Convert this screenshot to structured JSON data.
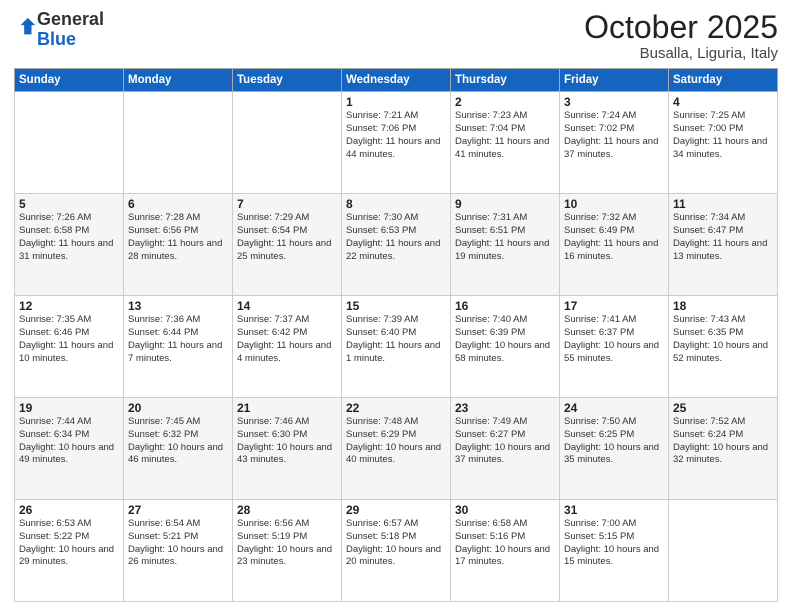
{
  "header": {
    "logo_general": "General",
    "logo_blue": "Blue",
    "month": "October 2025",
    "location": "Busalla, Liguria, Italy"
  },
  "weekdays": [
    "Sunday",
    "Monday",
    "Tuesday",
    "Wednesday",
    "Thursday",
    "Friday",
    "Saturday"
  ],
  "weeks": [
    [
      {
        "day": "",
        "info": ""
      },
      {
        "day": "",
        "info": ""
      },
      {
        "day": "",
        "info": ""
      },
      {
        "day": "1",
        "info": "Sunrise: 7:21 AM\nSunset: 7:06 PM\nDaylight: 11 hours and 44 minutes."
      },
      {
        "day": "2",
        "info": "Sunrise: 7:23 AM\nSunset: 7:04 PM\nDaylight: 11 hours and 41 minutes."
      },
      {
        "day": "3",
        "info": "Sunrise: 7:24 AM\nSunset: 7:02 PM\nDaylight: 11 hours and 37 minutes."
      },
      {
        "day": "4",
        "info": "Sunrise: 7:25 AM\nSunset: 7:00 PM\nDaylight: 11 hours and 34 minutes."
      }
    ],
    [
      {
        "day": "5",
        "info": "Sunrise: 7:26 AM\nSunset: 6:58 PM\nDaylight: 11 hours and 31 minutes."
      },
      {
        "day": "6",
        "info": "Sunrise: 7:28 AM\nSunset: 6:56 PM\nDaylight: 11 hours and 28 minutes."
      },
      {
        "day": "7",
        "info": "Sunrise: 7:29 AM\nSunset: 6:54 PM\nDaylight: 11 hours and 25 minutes."
      },
      {
        "day": "8",
        "info": "Sunrise: 7:30 AM\nSunset: 6:53 PM\nDaylight: 11 hours and 22 minutes."
      },
      {
        "day": "9",
        "info": "Sunrise: 7:31 AM\nSunset: 6:51 PM\nDaylight: 11 hours and 19 minutes."
      },
      {
        "day": "10",
        "info": "Sunrise: 7:32 AM\nSunset: 6:49 PM\nDaylight: 11 hours and 16 minutes."
      },
      {
        "day": "11",
        "info": "Sunrise: 7:34 AM\nSunset: 6:47 PM\nDaylight: 11 hours and 13 minutes."
      }
    ],
    [
      {
        "day": "12",
        "info": "Sunrise: 7:35 AM\nSunset: 6:46 PM\nDaylight: 11 hours and 10 minutes."
      },
      {
        "day": "13",
        "info": "Sunrise: 7:36 AM\nSunset: 6:44 PM\nDaylight: 11 hours and 7 minutes."
      },
      {
        "day": "14",
        "info": "Sunrise: 7:37 AM\nSunset: 6:42 PM\nDaylight: 11 hours and 4 minutes."
      },
      {
        "day": "15",
        "info": "Sunrise: 7:39 AM\nSunset: 6:40 PM\nDaylight: 11 hours and 1 minute."
      },
      {
        "day": "16",
        "info": "Sunrise: 7:40 AM\nSunset: 6:39 PM\nDaylight: 10 hours and 58 minutes."
      },
      {
        "day": "17",
        "info": "Sunrise: 7:41 AM\nSunset: 6:37 PM\nDaylight: 10 hours and 55 minutes."
      },
      {
        "day": "18",
        "info": "Sunrise: 7:43 AM\nSunset: 6:35 PM\nDaylight: 10 hours and 52 minutes."
      }
    ],
    [
      {
        "day": "19",
        "info": "Sunrise: 7:44 AM\nSunset: 6:34 PM\nDaylight: 10 hours and 49 minutes."
      },
      {
        "day": "20",
        "info": "Sunrise: 7:45 AM\nSunset: 6:32 PM\nDaylight: 10 hours and 46 minutes."
      },
      {
        "day": "21",
        "info": "Sunrise: 7:46 AM\nSunset: 6:30 PM\nDaylight: 10 hours and 43 minutes."
      },
      {
        "day": "22",
        "info": "Sunrise: 7:48 AM\nSunset: 6:29 PM\nDaylight: 10 hours and 40 minutes."
      },
      {
        "day": "23",
        "info": "Sunrise: 7:49 AM\nSunset: 6:27 PM\nDaylight: 10 hours and 37 minutes."
      },
      {
        "day": "24",
        "info": "Sunrise: 7:50 AM\nSunset: 6:25 PM\nDaylight: 10 hours and 35 minutes."
      },
      {
        "day": "25",
        "info": "Sunrise: 7:52 AM\nSunset: 6:24 PM\nDaylight: 10 hours and 32 minutes."
      }
    ],
    [
      {
        "day": "26",
        "info": "Sunrise: 6:53 AM\nSunset: 5:22 PM\nDaylight: 10 hours and 29 minutes."
      },
      {
        "day": "27",
        "info": "Sunrise: 6:54 AM\nSunset: 5:21 PM\nDaylight: 10 hours and 26 minutes."
      },
      {
        "day": "28",
        "info": "Sunrise: 6:56 AM\nSunset: 5:19 PM\nDaylight: 10 hours and 23 minutes."
      },
      {
        "day": "29",
        "info": "Sunrise: 6:57 AM\nSunset: 5:18 PM\nDaylight: 10 hours and 20 minutes."
      },
      {
        "day": "30",
        "info": "Sunrise: 6:58 AM\nSunset: 5:16 PM\nDaylight: 10 hours and 17 minutes."
      },
      {
        "day": "31",
        "info": "Sunrise: 7:00 AM\nSunset: 5:15 PM\nDaylight: 10 hours and 15 minutes."
      },
      {
        "day": "",
        "info": ""
      }
    ]
  ]
}
